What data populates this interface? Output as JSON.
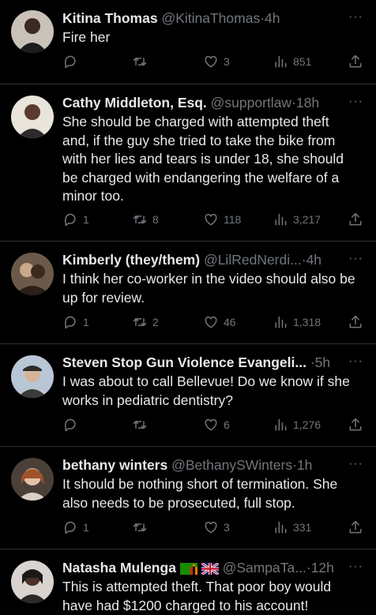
{
  "tweets": [
    {
      "name": "Kitina Thomas",
      "handle": "@KitinaThomas",
      "time": "4h",
      "text": "Fire her",
      "replies": "",
      "retweets": "",
      "likes": "3",
      "views": "851"
    },
    {
      "name": "Cathy Middleton, Esq.",
      "handle": "@supportlaw",
      "time": "18h",
      "text": "She should be charged with attempted theft and, if the  guy she tried to take the bike from with her lies and tears is under 18, she should be charged with endangering the welfare of a minor too.",
      "replies": "1",
      "retweets": "8",
      "likes": "118",
      "views": "3,217"
    },
    {
      "name": "Kimberly (they/them)",
      "handle": "@LilRedNerdi...",
      "time": "4h",
      "text": "I think her co-worker in the video should also be up for review.",
      "replies": "1",
      "retweets": "2",
      "likes": "46",
      "views": "1,318"
    },
    {
      "name": "Steven Stop Gun Violence Evangeli...",
      "handle": "",
      "time": "5h",
      "text": "I was about to call Bellevue! Do we know if she works in pediatric dentistry?",
      "replies": "",
      "retweets": "",
      "likes": "6",
      "views": "1,276"
    },
    {
      "name": "bethany winters",
      "handle": "@BethanySWinters",
      "time": "1h",
      "text": "It should be nothing short of termination. She also needs to be prosecuted, full stop.",
      "replies": "1",
      "retweets": "",
      "likes": "3",
      "views": "331"
    },
    {
      "name": "Natasha Mulenga",
      "handle": "@SampaTa...",
      "time": "12h",
      "text": "This is attempted theft. That poor boy would have had $1200 charged to his account!",
      "replies": "",
      "retweets": "",
      "likes": "",
      "views": ""
    }
  ],
  "ui": {
    "dot": "·",
    "more": "···"
  },
  "icons": [
    "reply-icon",
    "retweet-icon",
    "like-icon",
    "views-icon",
    "share-icon",
    "more-icon",
    "zambia-flag-icon",
    "uk-flag-icon"
  ],
  "colors": {
    "background": "#000000",
    "text": "#e7e9ea",
    "secondary": "#71767b",
    "divider": "#2f3336"
  }
}
